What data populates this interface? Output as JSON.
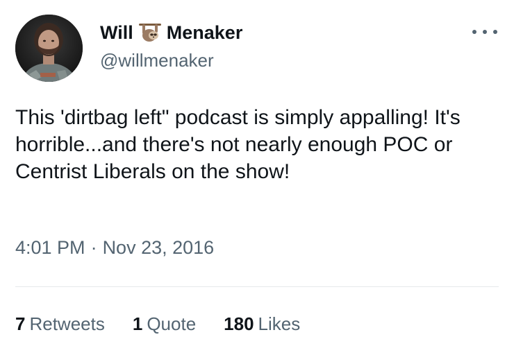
{
  "author": {
    "name_first": "Will",
    "name_last": "Menaker",
    "handle": "@willmenaker",
    "name_emoji": "sloth-emoji"
  },
  "tweet": {
    "text": "This 'dirtbag left\" podcast is simply appalling! It's horrible...and there's not nearly enough POC or Centrist Liberals on the show!",
    "time": "4:01 PM",
    "separator": "·",
    "date": "Nov 23, 2016"
  },
  "stats": {
    "retweets_count": "7",
    "retweets_label": "Retweets",
    "quotes_count": "1",
    "quotes_label": "Quote",
    "likes_count": "180",
    "likes_label": "Likes"
  },
  "icons": {
    "more": "more-horizontal-icon"
  },
  "colors": {
    "text_primary": "#0f1419",
    "text_secondary": "#536471",
    "divider": "#e6e9eb"
  }
}
